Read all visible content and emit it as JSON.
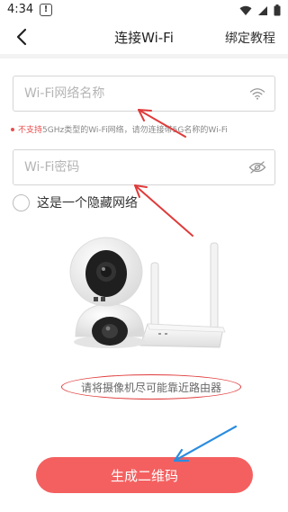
{
  "status_bar": {
    "time": "4:34",
    "alert_glyph": "!"
  },
  "header": {
    "title": "连接Wi-Fi",
    "right_link": "绑定教程",
    "back_icon": "chevron-left-icon"
  },
  "form": {
    "ssid": {
      "placeholder": "Wi-Fi网络名称",
      "value": "",
      "icon": "wifi-icon"
    },
    "notice": {
      "highlight": "不支持",
      "text": "5GHz类型的Wi-Fi网络，请勿连接带5G名称的Wi-Fi"
    },
    "password": {
      "placeholder": "Wi-Fi密码",
      "value": "",
      "icon": "eye-off-icon"
    },
    "hidden_network": {
      "label": "这是一个隐藏网络",
      "checked": false
    }
  },
  "hint": "请将摄像机尽可能靠近路由器",
  "primary_button": "生成二维码",
  "colors": {
    "accent": "#f46060",
    "annotation_red": "#e03a3a",
    "annotation_blue": "#2b8de0"
  }
}
